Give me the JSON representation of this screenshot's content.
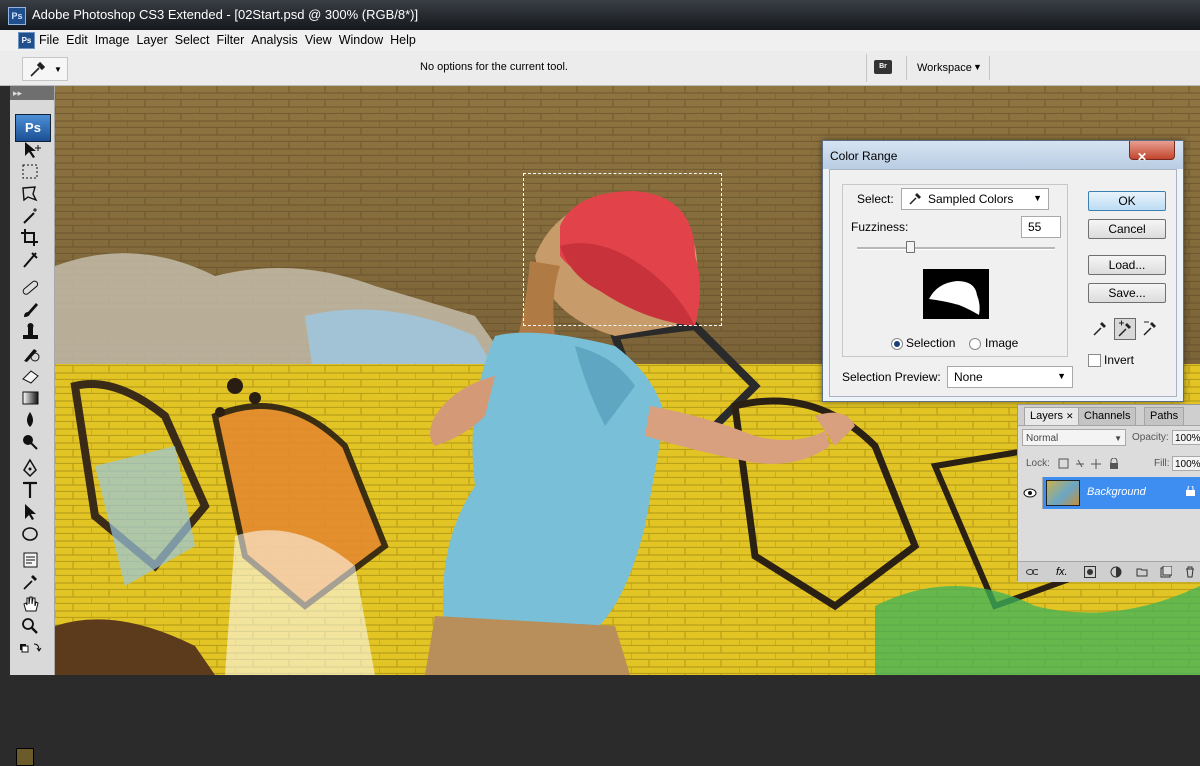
{
  "window": {
    "app_badge": "Ps",
    "title": "Adobe Photoshop CS3 Extended - [02Start.psd @ 300% (RGB/8*)]"
  },
  "menu": [
    "File",
    "Edit",
    "Image",
    "Layer",
    "Select",
    "Filter",
    "Analysis",
    "View",
    "Window",
    "Help"
  ],
  "options_bar": {
    "message": "No options for the current tool.",
    "bridge_label": "Br",
    "workspace_label": "Workspace"
  },
  "toolbox": {
    "badge": "Ps",
    "tools": [
      "move-tool",
      "marquee-tool",
      "lasso-tool",
      "magic-wand-tool",
      "crop-tool",
      "slice-tool",
      "healing-brush-tool",
      "brush-tool",
      "clone-stamp-tool",
      "history-brush-tool",
      "eraser-tool",
      "gradient-tool",
      "blur-tool",
      "dodge-tool",
      "pen-tool",
      "type-tool",
      "path-selection-tool",
      "ellipse-tool",
      "notes-tool",
      "eyedropper-tool",
      "hand-tool",
      "zoom-tool"
    ],
    "foreground_color": "#6b5a2a"
  },
  "dialog": {
    "title": "Color Range",
    "select_label": "Select:",
    "select_value": "Sampled Colors",
    "fuzziness_label": "Fuzziness:",
    "fuzziness_value": "55",
    "fuzziness_fraction": 0.27,
    "radio_selection": "Selection",
    "radio_image": "Image",
    "selection_preview_label": "Selection Preview:",
    "selection_preview_value": "None",
    "buttons": {
      "ok": "OK",
      "cancel": "Cancel",
      "load": "Load...",
      "save": "Save..."
    },
    "invert_label": "Invert",
    "invert_checked": false
  },
  "layers_panel": {
    "tabs": [
      {
        "label": "Layers",
        "active": true
      },
      {
        "label": "Channels",
        "active": false
      },
      {
        "label": "Paths",
        "active": false
      }
    ],
    "blend_mode": "Normal",
    "opacity_label": "Opacity:",
    "opacity_value": "100%",
    "lock_label": "Lock:",
    "fill_label": "Fill:",
    "fill_value": "100%",
    "layer_name": "Background",
    "highlight_color": "#3d8ef0"
  },
  "colors": {
    "cap": "#e2434b",
    "shirt": "#79bfd8",
    "wall_top": "#8b6e3e",
    "graffiti_yellow": "#e4c623"
  }
}
